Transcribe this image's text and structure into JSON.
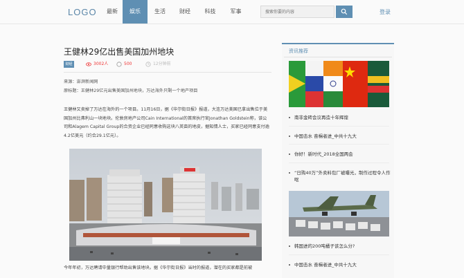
{
  "header": {
    "logo": "LOGO",
    "nav": [
      {
        "label": "最新",
        "active": false
      },
      {
        "label": "娱乐",
        "active": true
      },
      {
        "label": "生活",
        "active": false
      },
      {
        "label": "财经",
        "active": false
      },
      {
        "label": "科技",
        "active": false
      },
      {
        "label": "军事",
        "active": false
      }
    ],
    "search_placeholder": "搜索你要的内容",
    "login": "登录"
  },
  "article": {
    "title": "王健林29亿出售美国加州地块",
    "tag": "财经",
    "views": "3002人",
    "comments": "500",
    "time": "12分钟前",
    "source_line": "来源：澎湃新闻网",
    "summary_line": "原标题：王健林29亿元出售美国加州地块，万达海外只剩一个地产项目",
    "para1": "王健林又卖掉了万达在海外的一个项目。11月16日，据《华尔街日报》报道，大连万达美国已拿出售位于美国加州比弗利山一块地块。伦敦房地产公司Cain International的首席执行官Jonathan Goldstein称，该公司和Alagem Capital Group的合资企业已经同意收购这块八英亩的地皮，据知情人士，买家已经同意支付逾4.2亿美元（约合29.1亿元）。",
    "para2": "今年年初，万达聘请中量银行帮助出售该地块。据《华尔街日报》当时的报道，潜在的买家都是前被"
  },
  "sidebar": {
    "title": "资讯推荐",
    "items": [
      "南非金砖会议再造十年辉煌",
      "中国击水 奋楫者进_中共十九大",
      "你好！新时代_2018全国两会",
      "“日购40万”外卖料包厂被曝光，制作过程令人作呕",
      "韩国进的200吨橘子该怎么分?",
      "中国击水 奋楫者进_中共十九大"
    ]
  },
  "colors": {
    "accent": "#5f8fb3",
    "red": "#e33"
  }
}
